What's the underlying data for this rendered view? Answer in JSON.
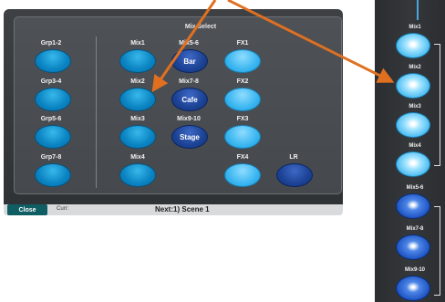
{
  "panel": {
    "title": "Mix Select",
    "groups": [
      "Grp1-2",
      "Grp3-4",
      "Grp5-6",
      "Grp7-8"
    ],
    "mixes": [
      "Mix1",
      "Mix2",
      "Mix3",
      "Mix4"
    ],
    "stereo_mixes": [
      "Mix5-6",
      "Mix7-8",
      "Mix9-10"
    ],
    "stereo_buttons": [
      "Bar",
      "Cafe",
      "Stage"
    ],
    "fx": [
      "FX1",
      "FX2",
      "FX3",
      "FX4"
    ],
    "lr": "LR",
    "close": "Close",
    "curr_label": "Curr:",
    "next_label": "Next:",
    "next_scene": "1) Scene 1"
  },
  "strip": {
    "labels": [
      "Mix1",
      "Mix2",
      "Mix3",
      "Mix4",
      "Mix5-6",
      "Mix7-8",
      "Mix9-10"
    ]
  },
  "colors": {
    "arrow": "#e07020",
    "mix_button": "#0a83c2",
    "fx_button": "#3ab6f0",
    "stereo_button": "#1c4294"
  }
}
